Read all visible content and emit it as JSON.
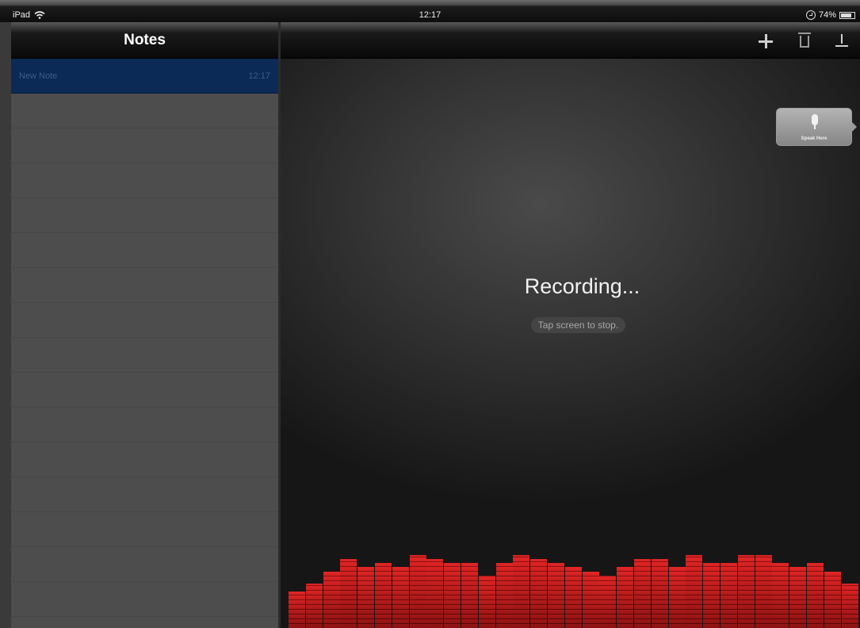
{
  "status_bar": {
    "device": "iPad",
    "time": "12:17",
    "battery": "74%"
  },
  "sidebar": {
    "title": "Notes",
    "notes": [
      {
        "title": "New Note",
        "time": "12:17",
        "selected": true
      }
    ]
  },
  "toolbar": {
    "buttons": [
      {
        "name": "add-note-button",
        "icon": "plus-icon"
      },
      {
        "name": "delete-note-button",
        "icon": "trash-icon"
      },
      {
        "name": "save-button",
        "icon": "download-icon"
      }
    ]
  },
  "speak_button": {
    "label": "Speak Here",
    "icon": "microphone-icon"
  },
  "recording": {
    "title": "Recording...",
    "hint": "Tap screen to stop."
  },
  "equalizer": {
    "color": "#e02020",
    "levels": [
      0.45,
      0.55,
      0.7,
      0.85,
      0.75,
      0.8,
      0.75,
      0.9,
      0.85,
      0.8,
      0.8,
      0.65,
      0.8,
      0.9,
      0.85,
      0.8,
      0.75,
      0.7,
      0.65,
      0.75,
      0.85,
      0.85,
      0.75,
      0.9,
      0.8,
      0.8,
      0.9,
      0.9,
      0.8,
      0.75,
      0.8,
      0.7,
      0.55
    ]
  },
  "colors": {
    "selected_row": "#0b2a55",
    "accent": "#e02020"
  }
}
